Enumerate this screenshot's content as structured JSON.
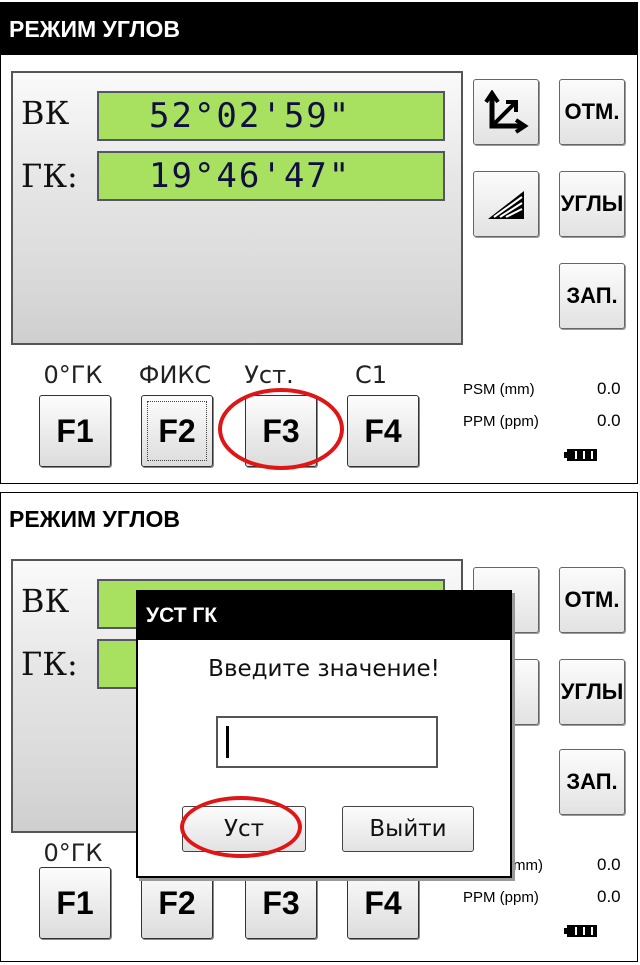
{
  "screen1": {
    "title": "РЕЖИМ УГЛОВ",
    "rows": [
      {
        "label": "ВК",
        "value": "52°02'59\""
      },
      {
        "label": "ГК:",
        "value": "19°46'47\""
      }
    ],
    "side_buttons": [
      {
        "icon": "coordinate-axes-icon"
      },
      {
        "label": "ОТМ."
      },
      {
        "icon": "tilt-wedge-icon"
      },
      {
        "label": "УГЛЫ"
      },
      {
        "label": "ЗАП."
      }
    ],
    "function_keys": [
      {
        "label": "0°ГК",
        "key": "F1"
      },
      {
        "label": "ФИКС",
        "key": "F2"
      },
      {
        "label": "Уст.",
        "key": "F3"
      },
      {
        "label": "C1",
        "key": "F4"
      }
    ],
    "info": {
      "psm_label": "PSM (mm)",
      "psm_value": "0.0",
      "ppm_label": "PPM (ppm)",
      "ppm_value": "0.0"
    }
  },
  "screen2": {
    "title": "РЕЖИМ УГЛОВ",
    "rows": [
      {
        "label": "ВК"
      },
      {
        "label": "ГК:"
      }
    ],
    "side_buttons": [
      {
        "label": "ОТМ."
      },
      {
        "label": "УГЛЫ"
      },
      {
        "label": "ЗАП."
      }
    ],
    "f1_label": "0°ГК",
    "function_keys": [
      "F1",
      "F2",
      "F3",
      "F4"
    ],
    "info": {
      "psm_value": "0.0",
      "psm_label_partial": "mm)",
      "ppm_label": "PPM (ppm)",
      "ppm_value": "0.0"
    },
    "dialog": {
      "title": "УСТ ГК",
      "message": "Введите значение!",
      "input_value": "",
      "ok_label": "Уст",
      "cancel_label": "Выйти"
    }
  },
  "colors": {
    "value_box": "#a8e05f",
    "highlight": "#e01515",
    "title_bar": "#000000"
  }
}
